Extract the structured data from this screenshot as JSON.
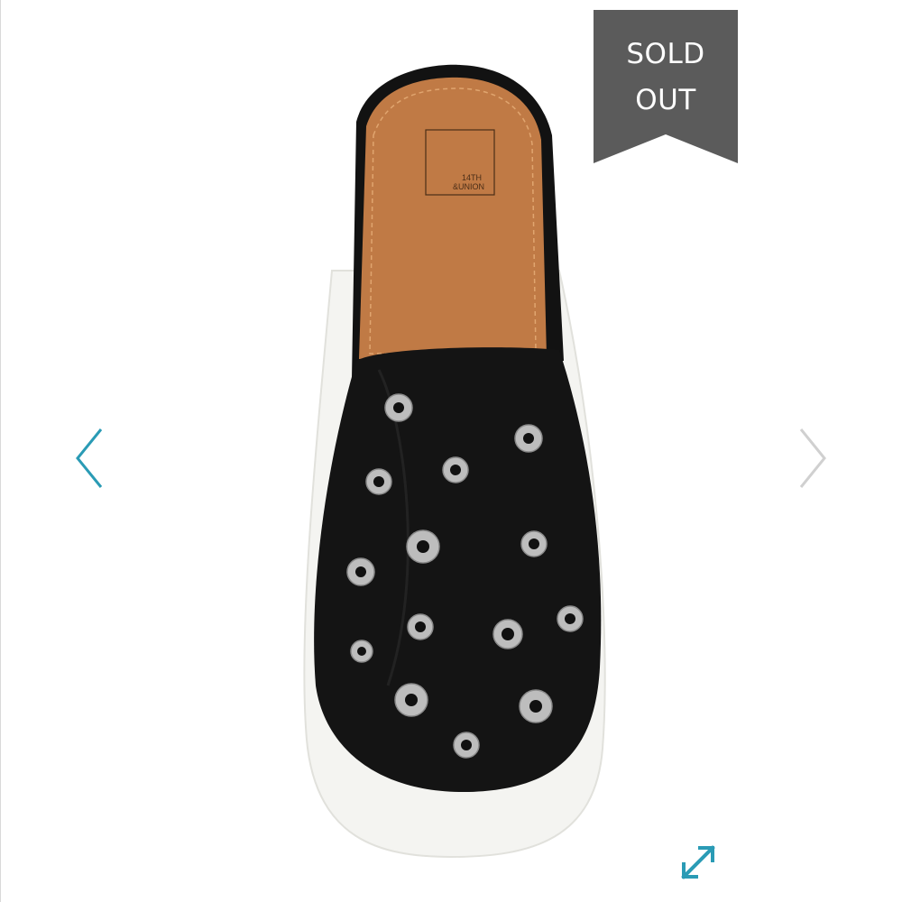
{
  "badge": {
    "line1": "SOLD",
    "line2": "OUT",
    "color": "#5b5b5b",
    "text_color": "#ffffff"
  },
  "product": {
    "logo_line1": "14TH",
    "logo_line2": "&UNION",
    "upper_color": "#141414",
    "insole_color": "#c07a45",
    "sole_color": "#f4f4f1"
  },
  "controls": {
    "prev_icon": "chevron-left-icon",
    "next_icon": "chevron-right-icon",
    "expand_icon": "expand-icon",
    "accent": "#2a9bb5",
    "inactive": "#d0d0d0"
  }
}
